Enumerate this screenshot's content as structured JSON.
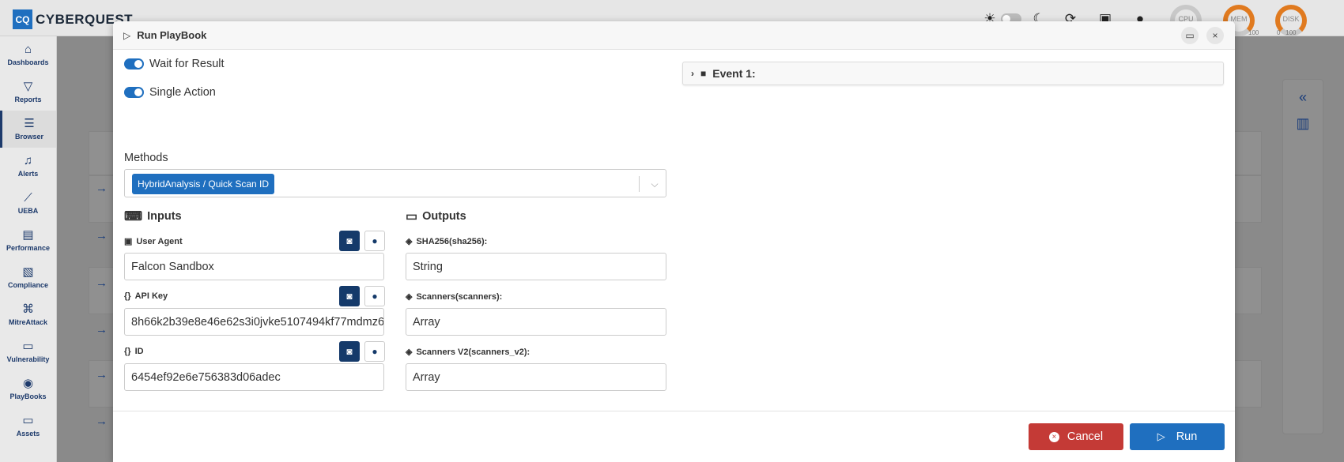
{
  "app": {
    "brand_mark": "CQ",
    "brand_name": "CYBERQUEST"
  },
  "topbar": {
    "gauges": [
      {
        "label": "CPU",
        "scale": ""
      },
      {
        "label": "MEM",
        "scale": "100"
      },
      {
        "label": "DISK",
        "scale": "0   100"
      }
    ]
  },
  "sidebar": {
    "items": [
      {
        "label": "Dashboards",
        "icon": "chart-area-icon"
      },
      {
        "label": "Reports",
        "icon": "filter-icon"
      },
      {
        "label": "Browser",
        "icon": "list-icon"
      },
      {
        "label": "Alerts",
        "icon": "bell-icon"
      },
      {
        "label": "UEBA",
        "icon": "chart-line-icon"
      },
      {
        "label": "Performance",
        "icon": "keyboard-icon"
      },
      {
        "label": "Compliance",
        "icon": "document-check-icon"
      },
      {
        "label": "MitreAttack",
        "icon": "command-icon"
      },
      {
        "label": "Vulnerability",
        "icon": "server-icon"
      },
      {
        "label": "PlayBooks",
        "icon": "playbook-icon"
      },
      {
        "label": "Assets",
        "icon": "laptop-icon"
      }
    ]
  },
  "modal": {
    "title": "Run PlayBook",
    "toggles": [
      {
        "label": "Wait for Result",
        "on": true
      },
      {
        "label": "Single Action",
        "on": true
      }
    ],
    "methods": {
      "label": "Methods",
      "selected": "HybridAnalysis / Quick Scan ID"
    },
    "inputs": {
      "title": "Inputs",
      "fields": [
        {
          "label": "User Agent",
          "value": "Falcon Sandbox",
          "icon": "id-card-icon"
        },
        {
          "label": "API Key",
          "value": "8h66k2b39e8e46e62s3i0jvke5107494kf77mdmz6",
          "icon": "braces-icon"
        },
        {
          "label": "ID",
          "value": "6454ef92e6e756383d06adec",
          "icon": "braces-icon"
        }
      ]
    },
    "outputs": {
      "title": "Outputs",
      "fields": [
        {
          "label": "SHA256(sha256):",
          "value": "String",
          "icon": "cube-icon"
        },
        {
          "label": "Scanners(scanners):",
          "value": "Array",
          "icon": "cube-icon"
        },
        {
          "label": "Scanners V2(scanners_v2):",
          "value": "Array",
          "icon": "cube-icon"
        }
      ]
    },
    "event_panel": {
      "title": "Event 1:"
    },
    "footer": {
      "cancel_label": "Cancel",
      "run_label": "Run"
    }
  },
  "colors": {
    "primary": "#1f6fbf",
    "danger": "#c43a36",
    "dark_button": "#153a6a"
  }
}
